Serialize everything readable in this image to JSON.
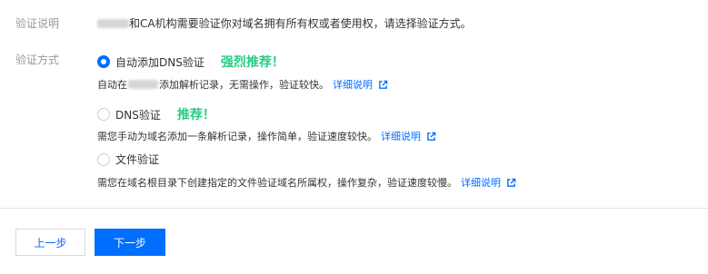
{
  "intro": {
    "label": "验证说明",
    "text_suffix": "和CA机构需要验证你对域名拥有所有权或者使用权，请选择验证方式。"
  },
  "method": {
    "label": "验证方式",
    "options": [
      {
        "label": "自动添加DNS验证",
        "recommend": "强烈推荐！",
        "checked": true,
        "hint_prefix": "自动在",
        "hint_suffix": "添加解析记录，无需操作，验证较快。",
        "link": "详细说明"
      },
      {
        "label": "DNS验证",
        "recommend": "推荐！",
        "checked": false,
        "hint": "需您手动为域名添加一条解析记录，操作简单，验证速度较快。",
        "link": "详细说明"
      },
      {
        "label": "文件验证",
        "checked": false,
        "hint": "需您在域名根目录下创建指定的文件验证域名所属权，操作复杂，验证速度较慢。",
        "link": "详细说明"
      }
    ]
  },
  "footer": {
    "prev_label": "上一步",
    "next_label": "下一步"
  },
  "colors": {
    "accent": "#006eff",
    "recommend": "#29cc85",
    "label": "#999999"
  },
  "icons": {
    "external_link": "external-link-icon",
    "radio": "radio-icon"
  }
}
